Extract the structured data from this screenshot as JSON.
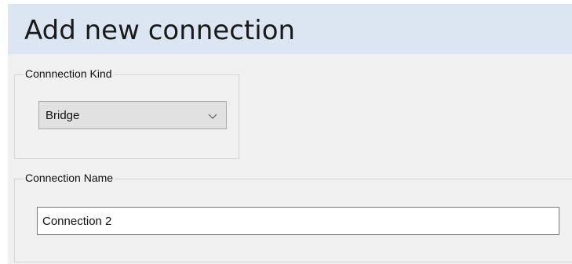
{
  "header": {
    "title": "Add new connection"
  },
  "connection_kind": {
    "legend": "Connnection Kind",
    "selected": "Bridge",
    "chevron_icon": "chevron-down-icon"
  },
  "connection_name": {
    "legend": "Connection Name",
    "value": "Connection 2"
  },
  "colors": {
    "header_background": "#dce6f2",
    "window_background": "#f0f0f0",
    "input_border": "#7a7a7a"
  }
}
